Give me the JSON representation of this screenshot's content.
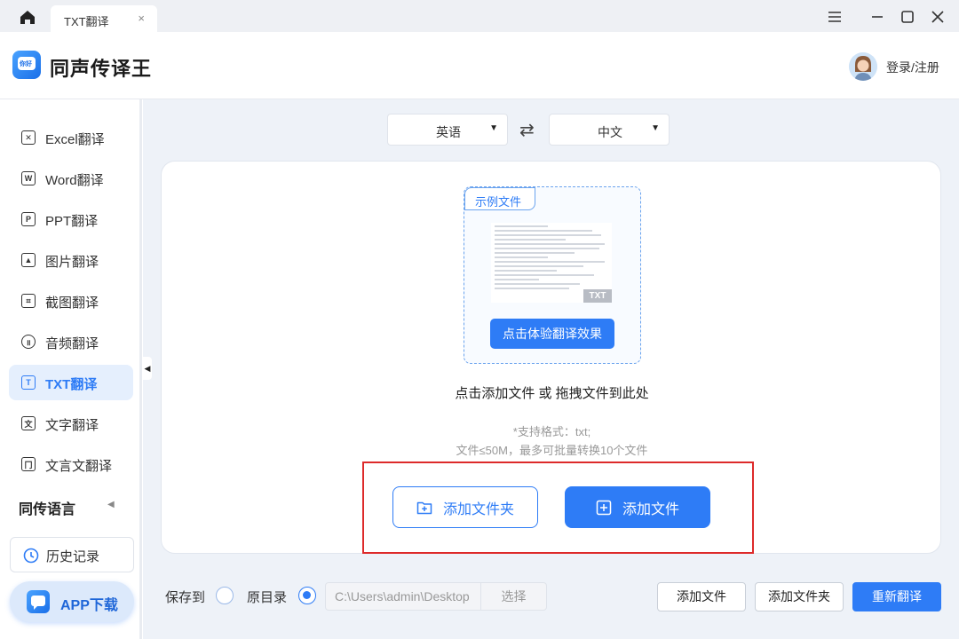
{
  "tab": {
    "title": "TXT翻译",
    "close": "×"
  },
  "window_controls": [
    "menu-icon",
    "minimize-icon",
    "maximize-icon",
    "close-icon"
  ],
  "header": {
    "app_title": "同声传译王",
    "login": "登录/注册",
    "logo_text": "你好"
  },
  "sidebar": {
    "items": [
      {
        "label": "Excel翻译",
        "icon": "excel-icon",
        "glyph": "✕"
      },
      {
        "label": "Word翻译",
        "icon": "word-icon",
        "glyph": "W"
      },
      {
        "label": "PPT翻译",
        "icon": "ppt-icon",
        "glyph": "P"
      },
      {
        "label": "图片翻译",
        "icon": "image-icon",
        "glyph": "▲"
      },
      {
        "label": "截图翻译",
        "icon": "screenshot-icon",
        "glyph": "⌗"
      },
      {
        "label": "音频翻译",
        "icon": "audio-icon",
        "glyph": "॥"
      },
      {
        "label": "TXT翻译",
        "icon": "txt-icon",
        "glyph": "T"
      },
      {
        "label": "文字翻译",
        "icon": "text-icon",
        "glyph": "文"
      },
      {
        "label": "文言文翻译",
        "icon": "classical-icon",
        "glyph": "冂"
      }
    ],
    "active_index": 6,
    "section": "同传语言",
    "history": "历史记录",
    "app_download": "APP下载"
  },
  "languages": {
    "source": "英语",
    "target": "中文"
  },
  "upload": {
    "example_tag": "示例文件",
    "badge": "TXT",
    "try_button": "点击体验翻译效果",
    "drop_hint": "点击添加文件 或 拖拽文件到此处",
    "formats": "*支持格式：txt;",
    "limits": "文件≤50M，最多可批量转换10个文件",
    "add_folder": "添加文件夹",
    "add_file": "添加文件"
  },
  "bottom": {
    "save_to": "保存到",
    "original_dir": "原目录",
    "path": "C:\\Users\\admin\\Desktop",
    "choose": "选择",
    "add_file": "添加文件",
    "add_folder": "添加文件夹",
    "retranslate": "重新翻译"
  },
  "colors": {
    "accent": "#2e7cf6",
    "highlight_frame": "#dd2a2a"
  }
}
